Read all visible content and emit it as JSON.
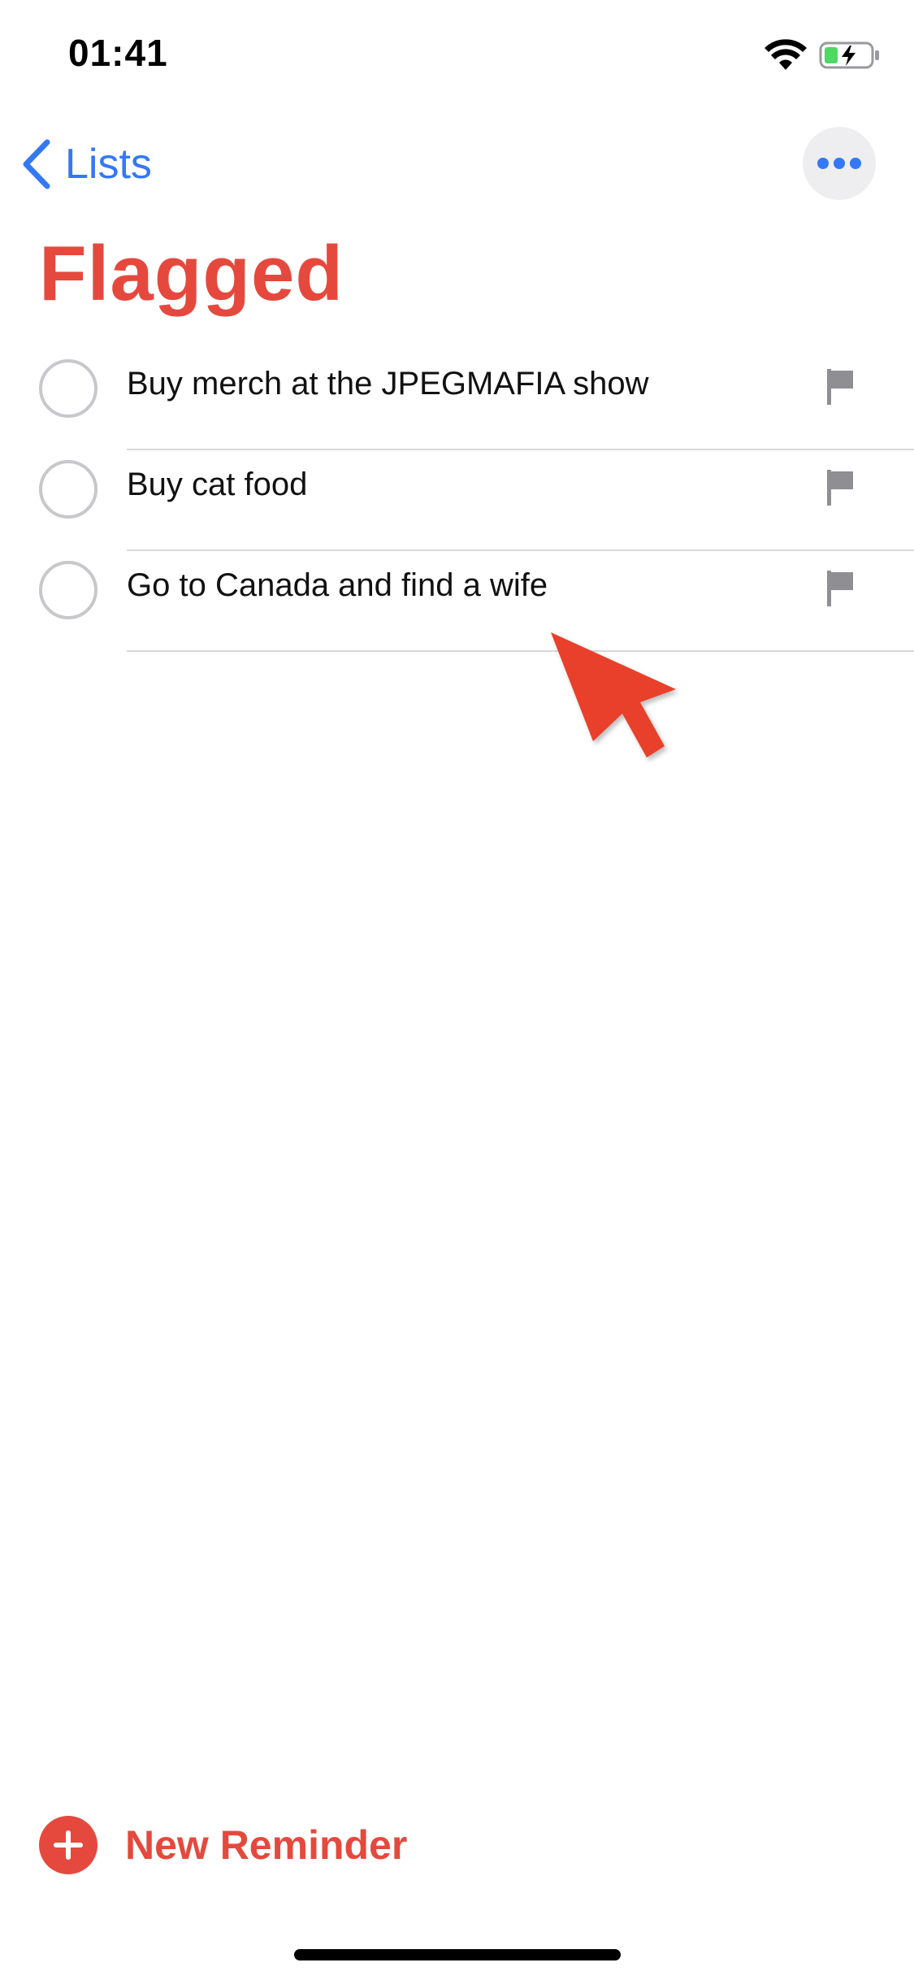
{
  "status_bar": {
    "time": "01:41",
    "wifi_icon": "wifi-icon",
    "battery_icon": "battery-charging-icon"
  },
  "nav": {
    "back_label": "Lists",
    "back_icon": "chevron-left-icon",
    "more_icon": "ellipsis-icon"
  },
  "page": {
    "title": "Flagged"
  },
  "reminders": [
    {
      "text": "Buy merch at the JPEGMAFIA show",
      "flagged": true
    },
    {
      "text": "Buy cat food",
      "flagged": true
    },
    {
      "text": "Go to Canada and find a wife",
      "flagged": true
    }
  ],
  "footer": {
    "new_reminder_label": "New Reminder",
    "new_reminder_icon": "plus-circle-icon"
  },
  "colors": {
    "accent_red": "#e5493d",
    "link_blue": "#3478f6",
    "flag_gray": "#8e8e93",
    "checkbox_border": "#c7c7cc",
    "battery_green": "#4cd964"
  }
}
